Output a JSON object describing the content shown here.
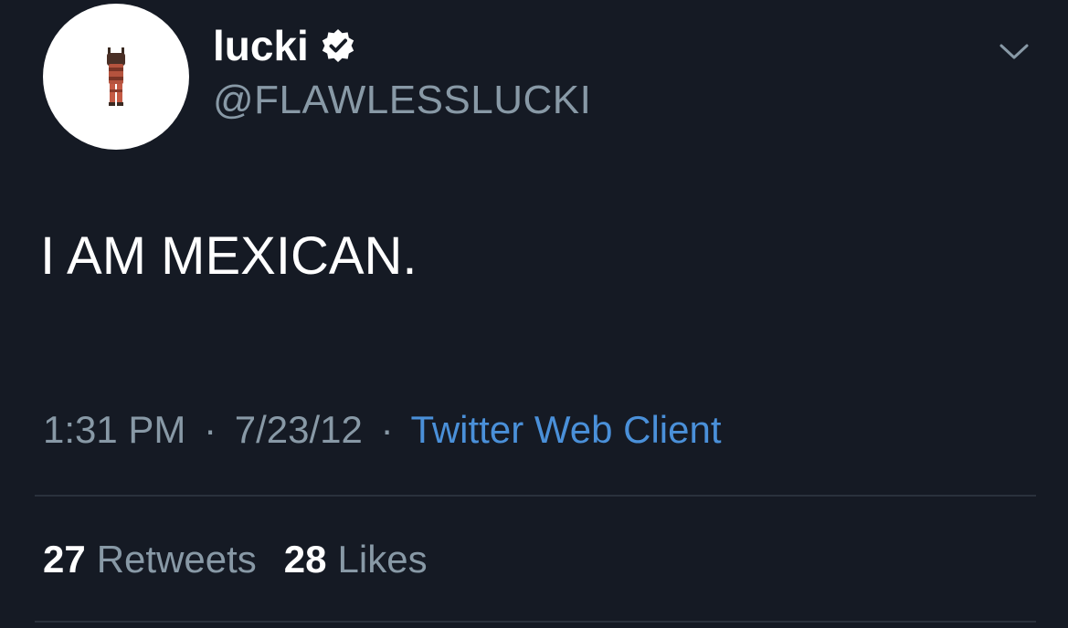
{
  "user": {
    "display_name": "lucki",
    "handle": "@FLAWLESSLUCKI",
    "verified": true,
    "avatar_icon": "figurine-avatar"
  },
  "tweet": {
    "text": "I AM MEXICAN.",
    "time": "1:31 PM",
    "date": "7/23/12",
    "separator": "·",
    "source": "Twitter Web Client"
  },
  "stats": {
    "retweets_count": "27",
    "retweets_label": "Retweets",
    "likes_count": "28",
    "likes_label": "Likes"
  },
  "colors": {
    "background": "#151a24",
    "primary_text": "#ffffff",
    "secondary_text": "#8899a6",
    "link": "#4a90d9",
    "divider": "#2a313c"
  }
}
